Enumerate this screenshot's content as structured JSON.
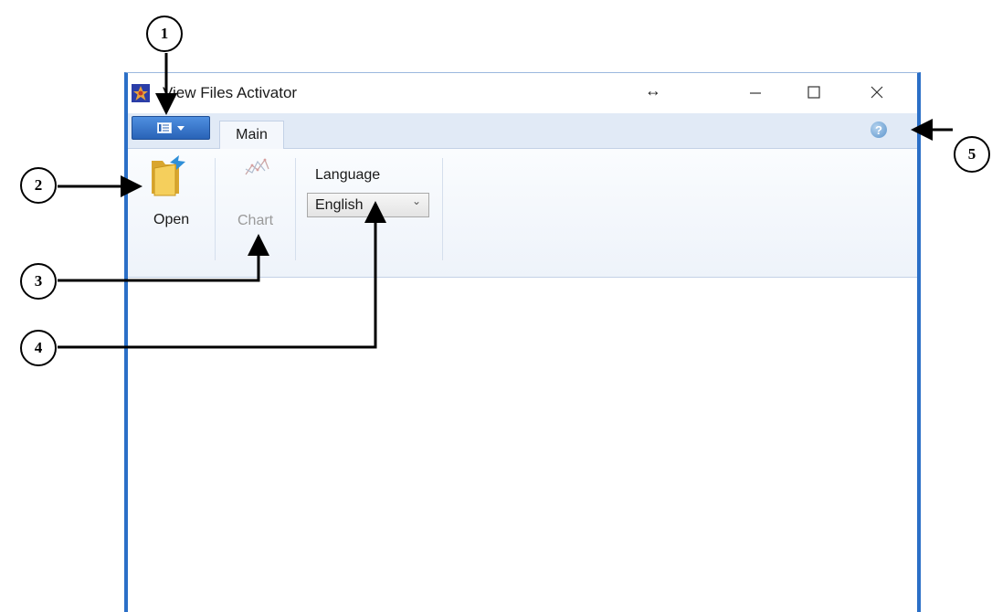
{
  "window": {
    "title": "View Files Activator",
    "icon": "app-icon"
  },
  "tabs": [
    {
      "label": "Main",
      "active": true
    }
  ],
  "ribbon": {
    "open_label": "Open",
    "chart_label": "Chart",
    "chart_enabled": false,
    "language_label": "Language",
    "language_value": "English"
  },
  "callouts": [
    "1",
    "2",
    "3",
    "4",
    "5"
  ],
  "colors": {
    "window_border": "#2b6fc7",
    "app_menu_button": "#2963b7",
    "ribbon_background": "#eef3fa"
  }
}
